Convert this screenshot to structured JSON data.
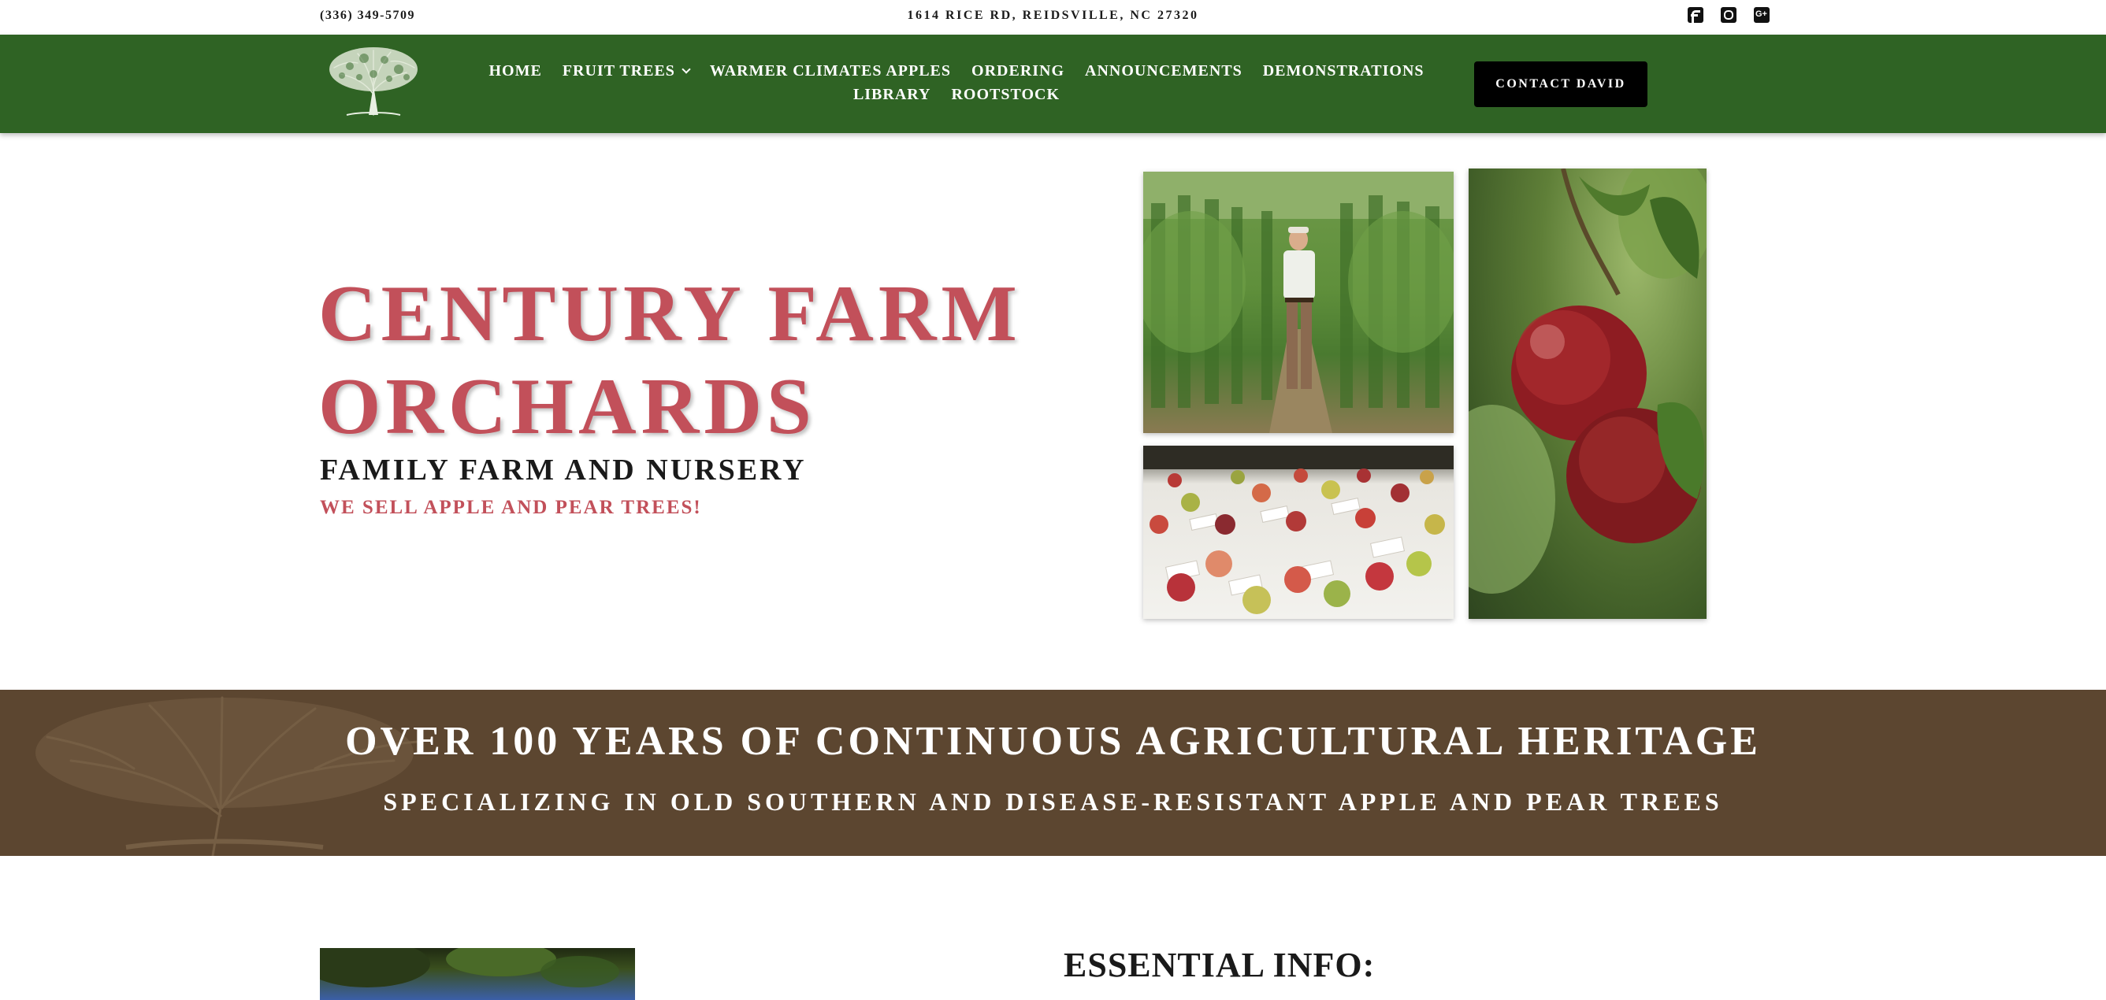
{
  "topbar": {
    "phone": "(336) 349-5709",
    "address": "1614 RICE RD, REIDSVILLE, NC 27320",
    "social_icons": [
      "facebook-icon",
      "instagram-icon",
      "google-plus-icon"
    ]
  },
  "nav": {
    "items": [
      {
        "label": "HOME"
      },
      {
        "label": "FRUIT TREES",
        "has_dropdown": true
      },
      {
        "label": "WARMER CLIMATES APPLES"
      },
      {
        "label": "ORDERING"
      },
      {
        "label": "ANNOUNCEMENTS"
      },
      {
        "label": "DEMONSTRATIONS"
      },
      {
        "label": "LIBRARY"
      },
      {
        "label": "ROOTSTOCK"
      }
    ],
    "contact_label": "CONTACT DAVID"
  },
  "hero": {
    "title_line1": "CENTURY FARM",
    "title_line2": "ORCHARDS",
    "subtitle": "FAMILY FARM AND NURSERY",
    "tagline": "WE SELL APPLE AND PEAR TREES!"
  },
  "banner": {
    "heading": "OVER 100 YEARS OF CONTINUOUS AGRICULTURAL HERITAGE",
    "subheading": "SPECIALIZING IN OLD SOUTHERN AND DISEASE-RESISTANT APPLE AND PEAR TREES"
  },
  "lower": {
    "heading": "ESSENTIAL INFO:"
  },
  "colors": {
    "nav_green": "#2f6324",
    "accent_red": "#c2505a",
    "banner_brown": "#5c4630",
    "button_black": "#000000"
  }
}
